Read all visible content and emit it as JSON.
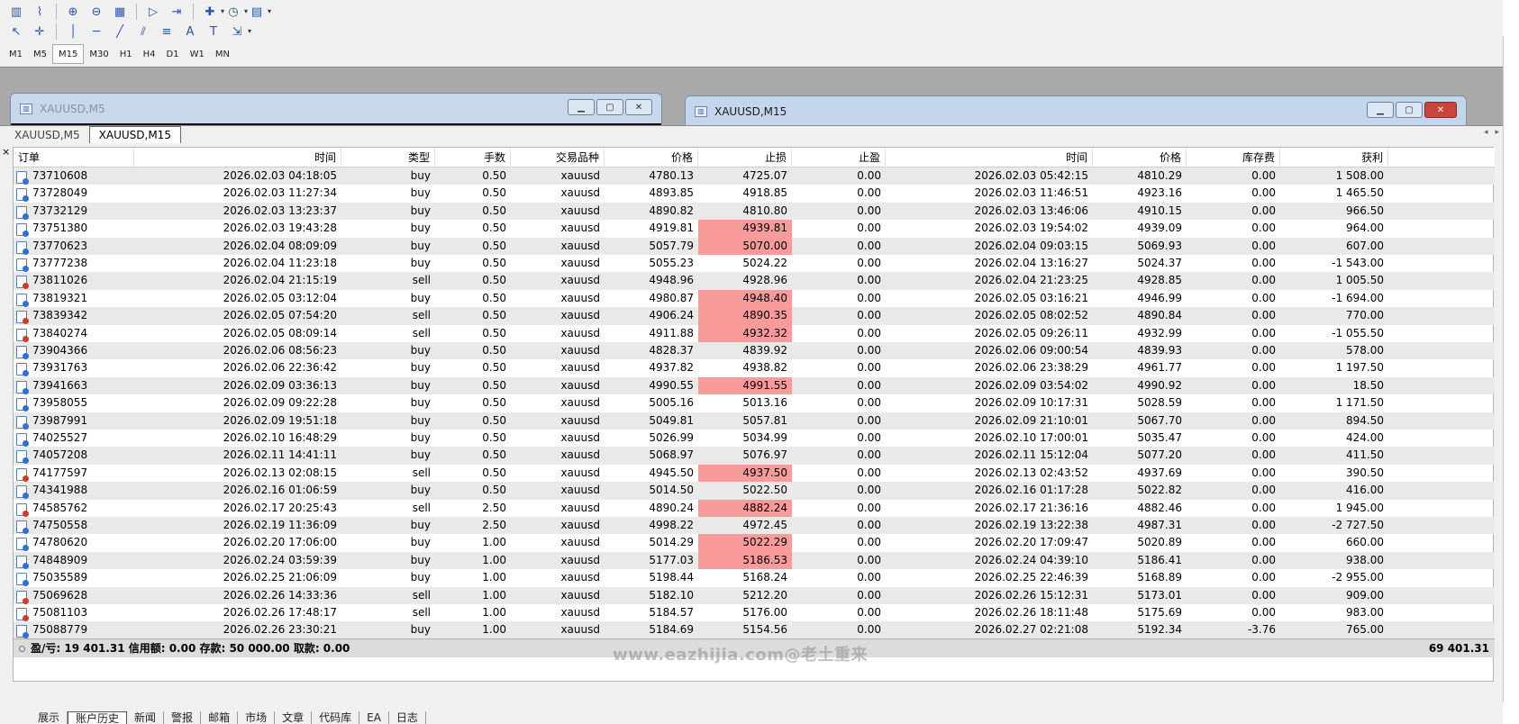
{
  "toolbar": {
    "row1": [
      "bar-chart-icon",
      "line-chart-icon",
      "zoom-in-icon",
      "zoom-out-icon",
      "tile-windows-icon",
      "autoscroll-icon",
      "chart-shift-icon",
      "indicators-icon",
      "periods-icon",
      "templates-icon"
    ],
    "row2": [
      "cursor-icon",
      "crosshair-icon",
      "vertical-line-icon",
      "horizontal-line-icon",
      "trend-line-icon",
      "channel-icon",
      "fibonacci-icon",
      "text-icon",
      "text-label-icon",
      "arrows-icon"
    ],
    "row2_glyphs": [
      "↖",
      "✛",
      "│",
      "─",
      "╱",
      "⫽",
      "≡",
      "A",
      "T",
      "⇲"
    ],
    "row1_glyphs": [
      "▥",
      "⌇",
      "⊕",
      "⊖",
      "▦",
      "▷",
      "⇥",
      "✚",
      "◷",
      "▤"
    ]
  },
  "timeframes": [
    "M1",
    "M5",
    "M15",
    "M30",
    "H1",
    "H4",
    "D1",
    "W1",
    "MN"
  ],
  "active_timeframe": "M15",
  "chart_windows": [
    {
      "title": "XAUUSD,M5"
    },
    {
      "title": "XAUUSD,M15"
    }
  ],
  "chart_tabs": [
    "XAUUSD,M5",
    "XAUUSD,M15"
  ],
  "active_chart_tab": "XAUUSD,M15",
  "table": {
    "headers": [
      "订单",
      "时间",
      "类型",
      "手数",
      "交易品种",
      "价格",
      "止损",
      "止盈",
      "时间",
      "价格",
      "库存费",
      "获利"
    ],
    "rows": [
      [
        "73710608",
        "2026.02.03 04:18:05",
        "buy",
        "0.50",
        "xauusd",
        "4780.13",
        "4725.07",
        "0.00",
        "2026.02.03 05:42:15",
        "4810.29",
        "0.00",
        "1 508.00",
        false
      ],
      [
        "73728049",
        "2026.02.03 11:27:34",
        "buy",
        "0.50",
        "xauusd",
        "4893.85",
        "4918.85",
        "0.00",
        "2026.02.03 11:46:51",
        "4923.16",
        "0.00",
        "1 465.50",
        false
      ],
      [
        "73732129",
        "2026.02.03 13:23:37",
        "buy",
        "0.50",
        "xauusd",
        "4890.82",
        "4810.80",
        "0.00",
        "2026.02.03 13:46:06",
        "4910.15",
        "0.00",
        "966.50",
        false
      ],
      [
        "73751380",
        "2026.02.03 19:43:28",
        "buy",
        "0.50",
        "xauusd",
        "4919.81",
        "4939.81",
        "0.00",
        "2026.02.03 19:54:02",
        "4939.09",
        "0.00",
        "964.00",
        true
      ],
      [
        "73770623",
        "2026.02.04 08:09:09",
        "buy",
        "0.50",
        "xauusd",
        "5057.79",
        "5070.00",
        "0.00",
        "2026.02.04 09:03:15",
        "5069.93",
        "0.00",
        "607.00",
        true
      ],
      [
        "73777238",
        "2026.02.04 11:23:18",
        "buy",
        "0.50",
        "xauusd",
        "5055.23",
        "5024.22",
        "0.00",
        "2026.02.04 13:16:27",
        "5024.37",
        "0.00",
        "-1 543.00",
        false
      ],
      [
        "73811026",
        "2026.02.04 21:15:19",
        "sell",
        "0.50",
        "xauusd",
        "4948.96",
        "4928.96",
        "0.00",
        "2026.02.04 21:23:25",
        "4928.85",
        "0.00",
        "1 005.50",
        false
      ],
      [
        "73819321",
        "2026.02.05 03:12:04",
        "buy",
        "0.50",
        "xauusd",
        "4980.87",
        "4948.40",
        "0.00",
        "2026.02.05 03:16:21",
        "4946.99",
        "0.00",
        "-1 694.00",
        true
      ],
      [
        "73839342",
        "2026.02.05 07:54:20",
        "sell",
        "0.50",
        "xauusd",
        "4906.24",
        "4890.35",
        "0.00",
        "2026.02.05 08:02:52",
        "4890.84",
        "0.00",
        "770.00",
        true
      ],
      [
        "73840274",
        "2026.02.05 08:09:14",
        "sell",
        "0.50",
        "xauusd",
        "4911.88",
        "4932.32",
        "0.00",
        "2026.02.05 09:26:11",
        "4932.99",
        "0.00",
        "-1 055.50",
        true
      ],
      [
        "73904366",
        "2026.02.06 08:56:23",
        "buy",
        "0.50",
        "xauusd",
        "4828.37",
        "4839.92",
        "0.00",
        "2026.02.06 09:00:54",
        "4839.93",
        "0.00",
        "578.00",
        false
      ],
      [
        "73931763",
        "2026.02.06 22:36:42",
        "buy",
        "0.50",
        "xauusd",
        "4937.82",
        "4938.82",
        "0.00",
        "2026.02.06 23:38:29",
        "4961.77",
        "0.00",
        "1 197.50",
        false
      ],
      [
        "73941663",
        "2026.02.09 03:36:13",
        "buy",
        "0.50",
        "xauusd",
        "4990.55",
        "4991.55",
        "0.00",
        "2026.02.09 03:54:02",
        "4990.92",
        "0.00",
        "18.50",
        true
      ],
      [
        "73958055",
        "2026.02.09 09:22:28",
        "buy",
        "0.50",
        "xauusd",
        "5005.16",
        "5013.16",
        "0.00",
        "2026.02.09 10:17:31",
        "5028.59",
        "0.00",
        "1 171.50",
        false
      ],
      [
        "73987991",
        "2026.02.09 19:51:18",
        "buy",
        "0.50",
        "xauusd",
        "5049.81",
        "5057.81",
        "0.00",
        "2026.02.09 21:10:01",
        "5067.70",
        "0.00",
        "894.50",
        false
      ],
      [
        "74025527",
        "2026.02.10 16:48:29",
        "buy",
        "0.50",
        "xauusd",
        "5026.99",
        "5034.99",
        "0.00",
        "2026.02.10 17:00:01",
        "5035.47",
        "0.00",
        "424.00",
        false
      ],
      [
        "74057208",
        "2026.02.11 14:41:11",
        "buy",
        "0.50",
        "xauusd",
        "5068.97",
        "5076.97",
        "0.00",
        "2026.02.11 15:12:04",
        "5077.20",
        "0.00",
        "411.50",
        false
      ],
      [
        "74177597",
        "2026.02.13 02:08:15",
        "sell",
        "0.50",
        "xauusd",
        "4945.50",
        "4937.50",
        "0.00",
        "2026.02.13 02:43:52",
        "4937.69",
        "0.00",
        "390.50",
        true
      ],
      [
        "74341988",
        "2026.02.16 01:06:59",
        "buy",
        "0.50",
        "xauusd",
        "5014.50",
        "5022.50",
        "0.00",
        "2026.02.16 01:17:28",
        "5022.82",
        "0.00",
        "416.00",
        false
      ],
      [
        "74585762",
        "2026.02.17 20:25:43",
        "sell",
        "2.50",
        "xauusd",
        "4890.24",
        "4882.24",
        "0.00",
        "2026.02.17 21:36:16",
        "4882.46",
        "0.00",
        "1 945.00",
        true
      ],
      [
        "74750558",
        "2026.02.19 11:36:09",
        "buy",
        "2.50",
        "xauusd",
        "4998.22",
        "4972.45",
        "0.00",
        "2026.02.19 13:22:38",
        "4987.31",
        "0.00",
        "-2 727.50",
        false
      ],
      [
        "74780620",
        "2026.02.20 17:06:00",
        "buy",
        "1.00",
        "xauusd",
        "5014.29",
        "5022.29",
        "0.00",
        "2026.02.20 17:09:47",
        "5020.89",
        "0.00",
        "660.00",
        true
      ],
      [
        "74848909",
        "2026.02.24 03:59:39",
        "buy",
        "1.00",
        "xauusd",
        "5177.03",
        "5186.53",
        "0.00",
        "2026.02.24 04:39:10",
        "5186.41",
        "0.00",
        "938.00",
        true
      ],
      [
        "75035589",
        "2026.02.25 21:06:09",
        "buy",
        "1.00",
        "xauusd",
        "5198.44",
        "5168.24",
        "0.00",
        "2026.02.25 22:46:39",
        "5168.89",
        "0.00",
        "-2 955.00",
        false
      ],
      [
        "75069628",
        "2026.02.26 14:33:36",
        "sell",
        "1.00",
        "xauusd",
        "5182.10",
        "5212.20",
        "0.00",
        "2026.02.26 15:12:31",
        "5173.01",
        "0.00",
        "909.00",
        false
      ],
      [
        "75081103",
        "2026.02.26 17:48:17",
        "sell",
        "1.00",
        "xauusd",
        "5184.57",
        "5176.00",
        "0.00",
        "2026.02.26 18:11:48",
        "5175.69",
        "0.00",
        "983.00",
        false
      ],
      [
        "75088779",
        "2026.02.26 23:30:21",
        "buy",
        "1.00",
        "xauusd",
        "5184.69",
        "5154.56",
        "0.00",
        "2026.02.27 02:21:08",
        "5192.34",
        "-3.76",
        "765.00",
        false
      ]
    ]
  },
  "summary": {
    "text": "盈/亏: 19 401.31  信用额: 0.00  存款: 50 000.00  取款: 0.00",
    "total": "69 401.31"
  },
  "bottom_tabs": [
    "展示",
    "账户历史",
    "新闻",
    "警报",
    "邮箱",
    "市场",
    "文章",
    "代码库",
    "EA",
    "日志"
  ],
  "active_bottom_tab": "账户历史",
  "watermark": "www.eazhijia.com@老土重来",
  "colors": {
    "stoploss_highlight": "#fa9b9b",
    "alt_row": "#e9e9e9",
    "footer": "#dcdcdc"
  }
}
